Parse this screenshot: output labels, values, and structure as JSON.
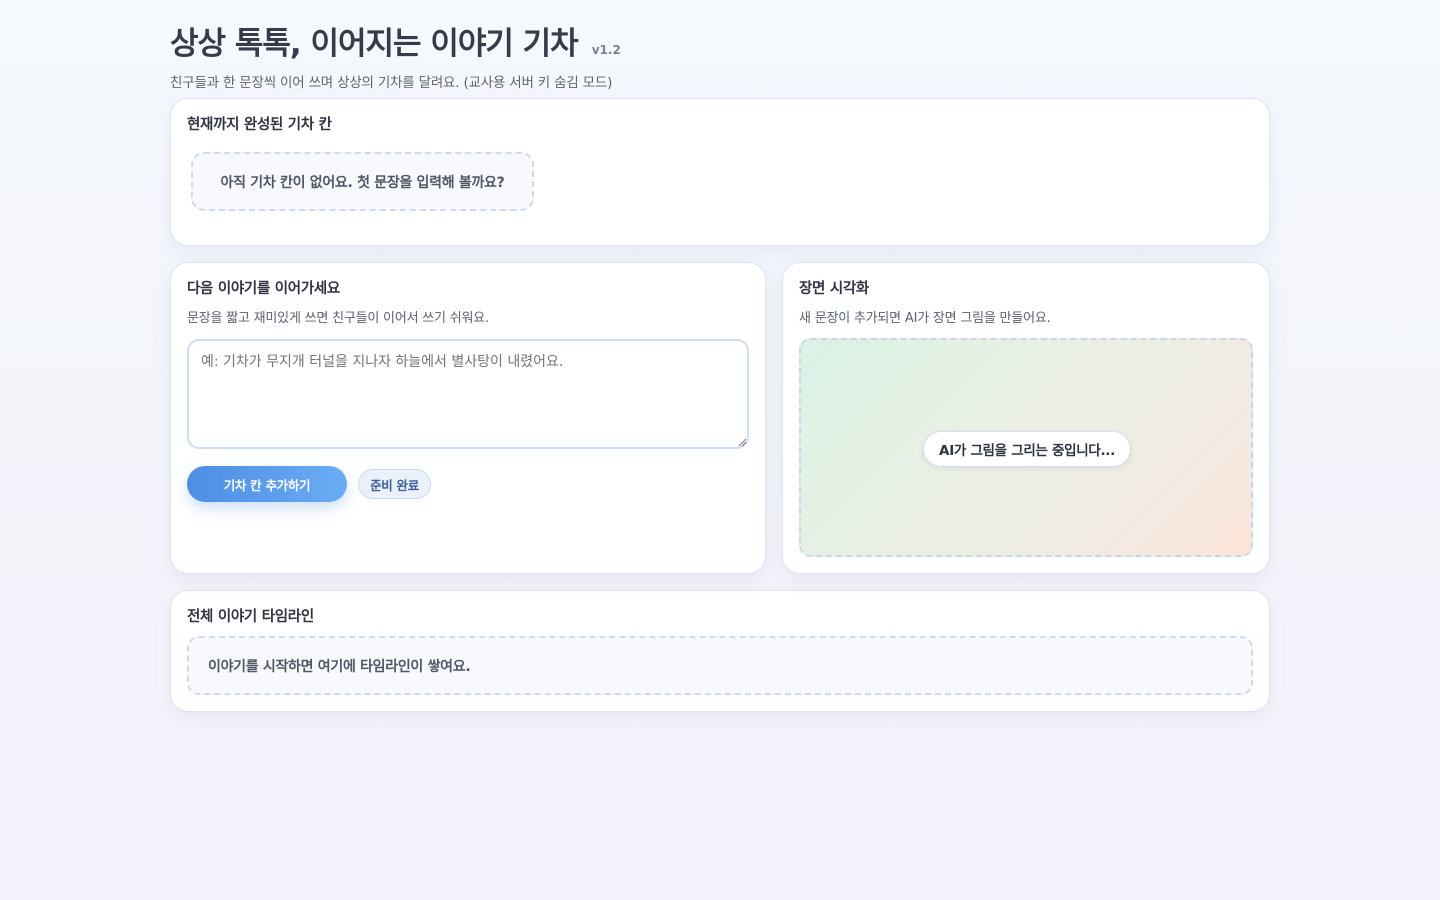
{
  "header": {
    "title": "상상 톡톡, 이어지는 이야기 기차",
    "version": "v1.2",
    "subtitle": "친구들과 한 문장씩 이어 쓰며 상상의 기차를 달려요. (교사용 서버 키 숨김 모드)"
  },
  "train": {
    "title": "현재까지 완성된 기차 칸",
    "empty_message": "아직 기차 칸이 없어요. 첫 문장을 입력해 볼까요?"
  },
  "input_panel": {
    "title": "다음 이야기를 이어가세요",
    "description": "문장을 짧고 재미있게 쓰면 친구들이 이어서 쓰기 쉬워요.",
    "value": "",
    "placeholder": "예: 기차가 무지개 터널을 지나자 하늘에서 별사탕이 내렸어요.",
    "add_button_label": "기차 칸 추가하기",
    "status_label": "준비 완료"
  },
  "visual_panel": {
    "title": "장면 시각화",
    "description": "새 문장이 추가되면 AI가 장면 그림을 만들어요.",
    "drawing_status": "AI가 그림을 그리는 중입니다..."
  },
  "timeline": {
    "title": "전체 이야기 타임라인",
    "empty_message": "이야기를 시작하면 여기에 타임라인이 쌓여요."
  },
  "colors": {
    "accent": "#4d8ee3",
    "accent_light": "#6aacf4",
    "text": "#2f3440",
    "badge_bg": "#eaf1fb"
  }
}
